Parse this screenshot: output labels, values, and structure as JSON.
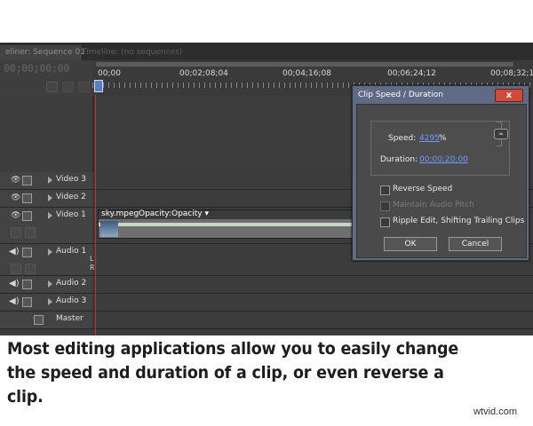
{
  "tabs": {
    "active": "eliner: Sequence 01",
    "inactive": "Timeline: (no sequences)"
  },
  "timeline": {
    "timecode": "00;00;00;00",
    "ruler_labels": [
      "00;00",
      "00;02;08;04",
      "00;04;16;08",
      "00;06;24;12",
      "00;08;32;16"
    ]
  },
  "tracks": [
    {
      "name": "Video 3",
      "type": "video"
    },
    {
      "name": "Video 2",
      "type": "video"
    },
    {
      "name": "Video 1",
      "type": "video"
    },
    {
      "name": "Audio 1",
      "type": "audio"
    },
    {
      "name": "Audio 2",
      "type": "audio"
    },
    {
      "name": "Audio 3",
      "type": "audio"
    },
    {
      "name": "Master",
      "type": "master"
    }
  ],
  "clip": {
    "name": "sky.mpeg",
    "effect": "Opacity:Opacity ▾"
  },
  "audio_marks": {
    "left": "L",
    "right": "R"
  },
  "dialog": {
    "title": "Clip Speed / Duration",
    "close_label": "x",
    "speed_label": "Speed:",
    "speed_value": "4295",
    "speed_unit": "%",
    "duration_label": "Duration:",
    "duration_value": "00;00;20;00",
    "reverse_speed": "Reverse Speed",
    "maintain_pitch": "Maintain Audio Pitch",
    "ripple_edit": "Ripple Edit, Shifting Trailing Clips",
    "ok_label": "OK",
    "cancel_label": "Cancel"
  },
  "caption": "Most editing applications allow you to easily change the speed and duration of a clip, or even reverse a clip.",
  "watermark": "wtvid.com",
  "colors": {
    "accent_link": "#6f9cff",
    "playhead": "#c43131",
    "dialog_frame": "#5f6b85"
  }
}
